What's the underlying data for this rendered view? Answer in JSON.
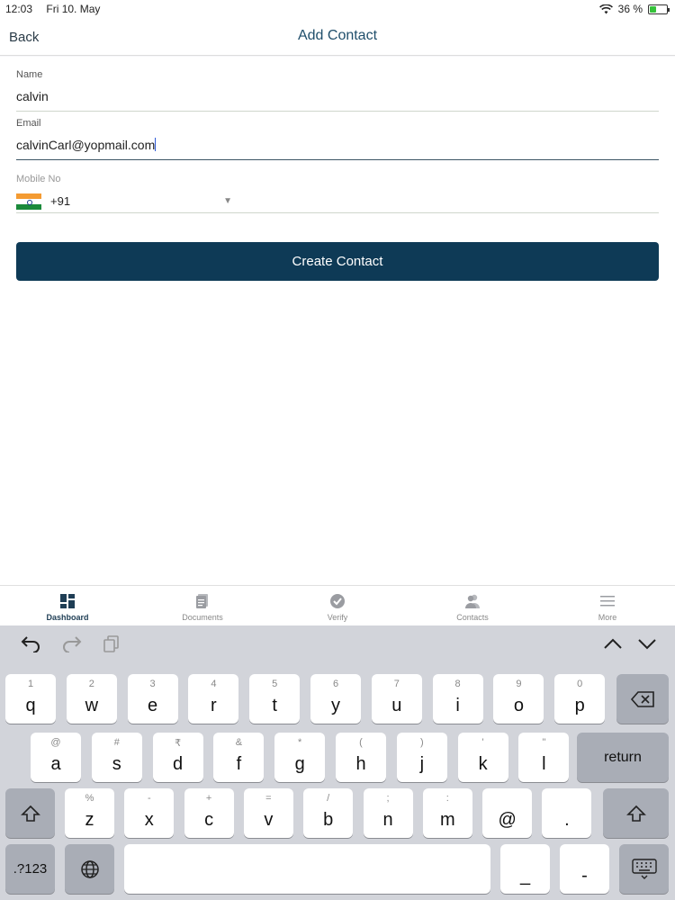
{
  "status_bar": {
    "time": "12:03",
    "date": "Fri 10. May",
    "battery": "36 %"
  },
  "nav": {
    "back_label": "Back",
    "title": "Add Contact"
  },
  "form": {
    "name_label": "Name",
    "name_value": "calvin",
    "email_label": "Email",
    "email_value": "calvinCarl@yopmail.com",
    "mobile_label": "Mobile No",
    "country_code": "+91",
    "create_label": "Create Contact"
  },
  "tabs": [
    {
      "label": "Dashboard",
      "icon": "dashboard-icon"
    },
    {
      "label": "Documents",
      "icon": "documents-icon"
    },
    {
      "label": "Verify",
      "icon": "verify-icon"
    },
    {
      "label": "Contacts",
      "icon": "contacts-icon"
    },
    {
      "label": "More",
      "icon": "menu-icon"
    }
  ],
  "keyboard": {
    "row1": [
      {
        "k": "q",
        "h": "1"
      },
      {
        "k": "w",
        "h": "2"
      },
      {
        "k": "e",
        "h": "3"
      },
      {
        "k": "r",
        "h": "4"
      },
      {
        "k": "t",
        "h": "5"
      },
      {
        "k": "y",
        "h": "6"
      },
      {
        "k": "u",
        "h": "7"
      },
      {
        "k": "i",
        "h": "8"
      },
      {
        "k": "o",
        "h": "9"
      },
      {
        "k": "p",
        "h": "0"
      }
    ],
    "row2": [
      {
        "k": "a",
        "h": "@"
      },
      {
        "k": "s",
        "h": "#"
      },
      {
        "k": "d",
        "h": "₹"
      },
      {
        "k": "f",
        "h": "&"
      },
      {
        "k": "g",
        "h": "*"
      },
      {
        "k": "h",
        "h": "("
      },
      {
        "k": "j",
        "h": ")"
      },
      {
        "k": "k",
        "h": "'"
      },
      {
        "k": "l",
        "h": "\""
      }
    ],
    "row3": [
      {
        "k": "z",
        "h": "%"
      },
      {
        "k": "x",
        "h": "-"
      },
      {
        "k": "c",
        "h": "+"
      },
      {
        "k": "v",
        "h": "="
      },
      {
        "k": "b",
        "h": "/"
      },
      {
        "k": "n",
        "h": ";"
      },
      {
        "k": "m",
        "h": ":"
      },
      {
        "k": "@",
        "h": ""
      },
      {
        "k": ".",
        "h": ""
      }
    ],
    "return_label": "return",
    "numbers_label": ".?123",
    "underscore": "_",
    "dash": "-"
  }
}
